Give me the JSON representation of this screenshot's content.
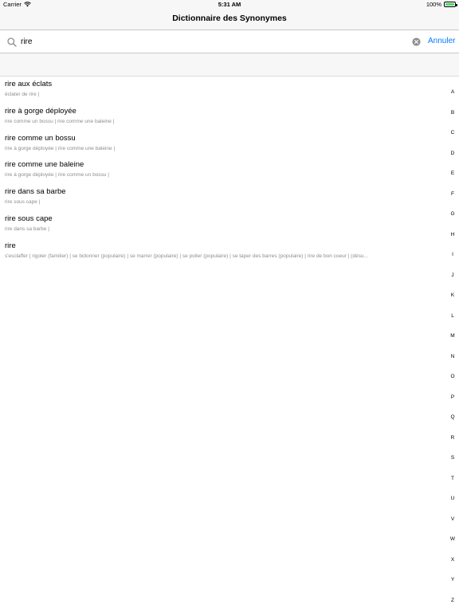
{
  "status_bar": {
    "carrier": "Carrier",
    "time": "5:31 AM",
    "battery": "100%",
    "battery_level": 1.0,
    "battery_color": "#4cd964"
  },
  "nav": {
    "title": "Dictionnaire des Synonymes"
  },
  "search": {
    "value": "rire",
    "cancel_label": "Annuler",
    "icon": "search-icon",
    "clear_icon": "clear-icon"
  },
  "accent_color": "#007aff",
  "results": [
    {
      "word": "rire aux éclats",
      "synonyms": "éclater de rire |"
    },
    {
      "word": "rire à gorge déployée",
      "synonyms": "rire comme un bossu | rire comme une baleine |"
    },
    {
      "word": "rire comme un bossu",
      "synonyms": "rire à gorge déployée | rire comme une baleine |"
    },
    {
      "word": "rire comme une baleine",
      "synonyms": "rire à gorge déployée | rire comme un bossu |"
    },
    {
      "word": "rire dans sa barbe",
      "synonyms": "rire sous cape |"
    },
    {
      "word": "rire sous cape",
      "synonyms": "rire dans sa barbe |"
    },
    {
      "word": "rire",
      "synonyms": "s'esclaffer | rigoler (familier) | se bidonner (populaire) | se marrer (populaire) | se poiler (populaire) | se taper des barres (populaire) | rire de bon coeur | (désu..."
    }
  ],
  "alphabet": [
    "A",
    "B",
    "C",
    "D",
    "E",
    "F",
    "G",
    "H",
    "I",
    "J",
    "K",
    "L",
    "M",
    "N",
    "O",
    "P",
    "Q",
    "R",
    "S",
    "T",
    "U",
    "V",
    "W",
    "X",
    "Y",
    "Z"
  ]
}
